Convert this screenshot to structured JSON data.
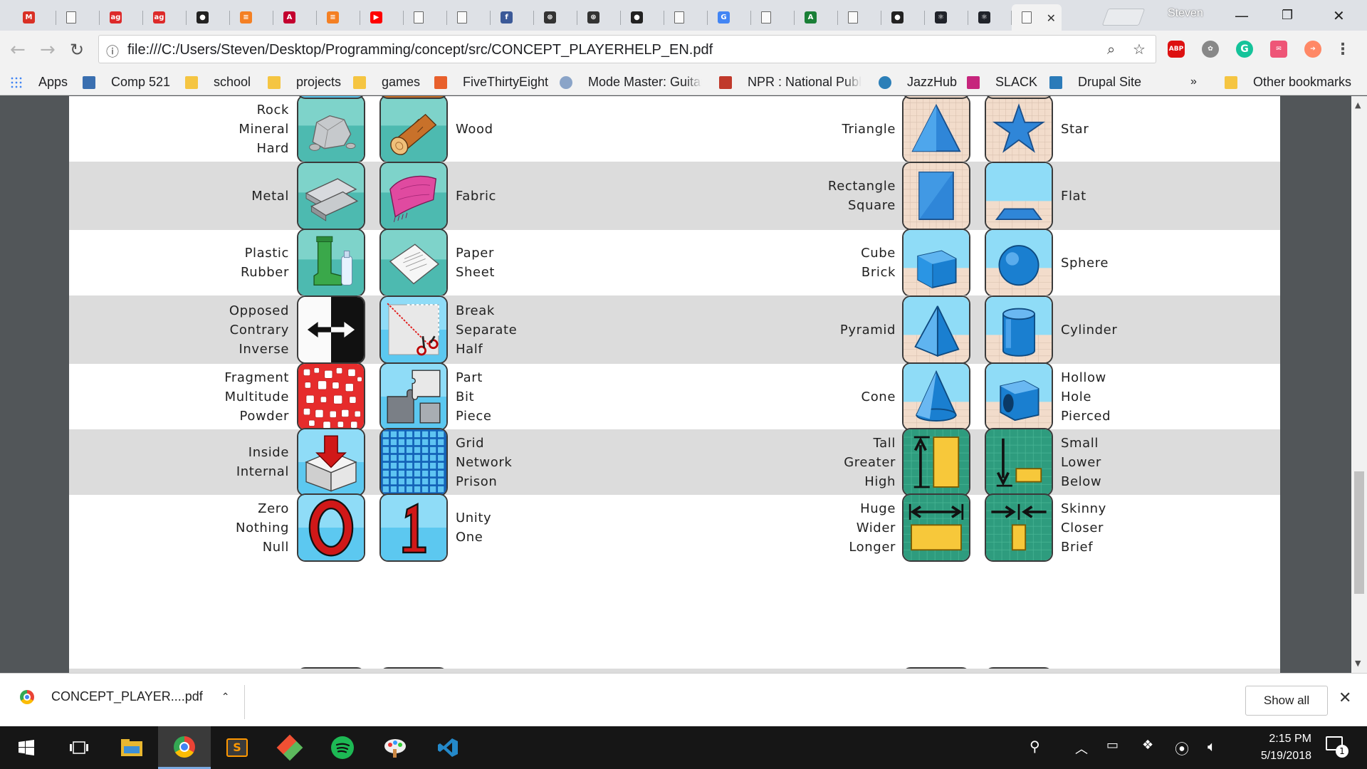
{
  "browser": {
    "profile_name": "Steven",
    "url": "file:///C:/Users/Steven/Desktop/Programming/concept/src/CONCEPT_PLAYERHELP_EN.pdf",
    "tabs": [
      {
        "icon": "gmail-icon",
        "color": "#d93025",
        "glyph": "M",
        "active": false
      },
      {
        "icon": "document-icon",
        "color": "#888888",
        "glyph": "",
        "active": false
      },
      {
        "icon": "ag-icon",
        "color": "#dd2a2a",
        "glyph": "ag",
        "active": false
      },
      {
        "icon": "ag-icon",
        "color": "#dd2a2a",
        "glyph": "ag",
        "active": false
      },
      {
        "icon": "github-icon",
        "color": "#222222",
        "glyph": "●",
        "active": false
      },
      {
        "icon": "stackoverflow-icon",
        "color": "#f48024",
        "glyph": "≡",
        "active": false
      },
      {
        "icon": "angular-icon",
        "color": "#c3002f",
        "glyph": "A",
        "active": false
      },
      {
        "icon": "stackoverflow-icon",
        "color": "#f48024",
        "glyph": "≡",
        "active": false
      },
      {
        "icon": "youtube-icon",
        "color": "#ff0000",
        "glyph": "▶",
        "active": false
      },
      {
        "icon": "document-icon",
        "color": "#888888",
        "glyph": "",
        "active": false
      },
      {
        "icon": "document-icon",
        "color": "#888888",
        "glyph": "",
        "active": false
      },
      {
        "icon": "facebook-icon",
        "color": "#3b5998",
        "glyph": "f",
        "active": false
      },
      {
        "icon": "circles-icon",
        "color": "#333333",
        "glyph": "⊛",
        "active": false
      },
      {
        "icon": "circles-icon",
        "color": "#333333",
        "glyph": "⊛",
        "active": false
      },
      {
        "icon": "github-icon",
        "color": "#222222",
        "glyph": "●",
        "active": false
      },
      {
        "icon": "document-icon",
        "color": "#888888",
        "glyph": "",
        "active": false
      },
      {
        "icon": "google-icon",
        "color": "#4285f4",
        "glyph": "G",
        "active": false
      },
      {
        "icon": "document-icon",
        "color": "#888888",
        "glyph": "",
        "active": false
      },
      {
        "icon": "terminal-icon",
        "color": "#1a7f37",
        "glyph": "A",
        "active": false
      },
      {
        "icon": "document-icon",
        "color": "#888888",
        "glyph": "",
        "active": false
      },
      {
        "icon": "github-icon",
        "color": "#222222",
        "glyph": "●",
        "active": false
      },
      {
        "icon": "react-icon",
        "color": "#20232a",
        "glyph": "⚛",
        "active": false
      },
      {
        "icon": "react-icon",
        "color": "#20232a",
        "glyph": "⚛",
        "active": false
      },
      {
        "icon": "document-icon",
        "color": "#888888",
        "glyph": "",
        "active": true
      }
    ],
    "bookmarks": [
      {
        "label": "Apps",
        "icon": "apps-grid-icon",
        "color": "#4285f4"
      },
      {
        "label": "Comp 521",
        "icon": "gear-bookmark-icon",
        "color": "#3a6fb0"
      },
      {
        "label": "school",
        "icon": "folder-icon",
        "color": "#f5c542"
      },
      {
        "label": "projects",
        "icon": "folder-icon",
        "color": "#f5c542"
      },
      {
        "label": "games",
        "icon": "folder-icon",
        "color": "#f5c542"
      },
      {
        "label": "FiveThirtyEight",
        "icon": "fivethirtyeight-icon",
        "color": "#e8602c"
      },
      {
        "label": "Mode Master: Guitar",
        "icon": "mode-master-icon",
        "color": "#8aa4c8"
      },
      {
        "label": "NPR : National Publi",
        "icon": "npr-icon",
        "color": "#c0392b"
      },
      {
        "label": "JazzHub",
        "icon": "jazzhub-icon",
        "color": "#2c7fb8"
      },
      {
        "label": "SLACK",
        "icon": "slack-icon",
        "color": "#c6257c"
      },
      {
        "label": "Drupal Site",
        "icon": "drupal-icon",
        "color": "#2b7bb9"
      }
    ],
    "bookmarks_overflow": "»",
    "other_bookmarks": "Other bookmarks"
  },
  "pdf": {
    "rows": [
      {
        "shade": false,
        "left": {
          "label": [
            "Rock",
            "Mineral",
            "Hard"
          ],
          "icon1": "rock-icon",
          "icon2": "wood-icon",
          "label2": [
            "Wood"
          ]
        },
        "right": {
          "label": [
            "Triangle"
          ],
          "icon1": "triangle-icon",
          "icon2": "star-icon",
          "label2": [
            "Star"
          ]
        }
      },
      {
        "shade": true,
        "left": {
          "label": [
            "Metal"
          ],
          "icon1": "metal-icon",
          "icon2": "fabric-icon",
          "label2": [
            "Fabric"
          ]
        },
        "right": {
          "label": [
            "Rectangle",
            "Square"
          ],
          "icon1": "rectangle-icon",
          "icon2": "flat-icon",
          "label2": [
            "Flat"
          ]
        }
      },
      {
        "shade": false,
        "left": {
          "label": [
            "Plastic",
            "Rubber"
          ],
          "icon1": "plastic-icon",
          "icon2": "paper-icon",
          "label2": [
            "Paper",
            "Sheet"
          ]
        },
        "right": {
          "label": [
            "Cube",
            "Brick"
          ],
          "icon1": "cube-icon",
          "icon2": "sphere-icon",
          "label2": [
            "Sphere"
          ]
        }
      },
      {
        "shade": true,
        "left": {
          "label": [
            "Opposed",
            "Contrary",
            "Inverse"
          ],
          "icon1": "opposed-icon",
          "icon2": "break-icon",
          "label2": [
            "Break",
            "Separate",
            "Half"
          ]
        },
        "right": {
          "label": [
            "Pyramid"
          ],
          "icon1": "pyramid-icon",
          "icon2": "cylinder-icon",
          "label2": [
            "Cylinder"
          ]
        }
      },
      {
        "shade": false,
        "left": {
          "label": [
            "Fragment",
            "Multitude",
            "Powder"
          ],
          "icon1": "fragment-icon",
          "icon2": "puzzle-icon",
          "label2": [
            "Part",
            "Bit",
            "Piece"
          ]
        },
        "right": {
          "label": [
            "Cone"
          ],
          "icon1": "cone-icon",
          "icon2": "hollow-icon",
          "label2": [
            "Hollow",
            "Hole",
            "Pierced"
          ]
        }
      },
      {
        "shade": true,
        "left": {
          "label": [
            "Inside",
            "Internal"
          ],
          "icon1": "inside-icon",
          "icon2": "grid-icon",
          "label2": [
            "Grid",
            "Network",
            "Prison"
          ]
        },
        "right": {
          "label": [
            "Tall",
            "Greater",
            "High"
          ],
          "icon1": "tall-icon",
          "icon2": "small-icon",
          "label2": [
            "Small",
            "Lower",
            "Below"
          ]
        }
      },
      {
        "shade": false,
        "left": {
          "label": [
            "Zero",
            "Nothing",
            "Null"
          ],
          "icon1": "zero-icon",
          "icon2": "one-icon",
          "label2": [
            "Unity",
            "One"
          ]
        },
        "right": {
          "label": [
            "Huge",
            "Wider",
            "Longer"
          ],
          "icon1": "huge-icon",
          "icon2": "skinny-icon",
          "label2": [
            "Skinny",
            "Closer",
            "Brief"
          ]
        }
      }
    ],
    "digits": {
      "zero": "0",
      "one": "1"
    }
  },
  "download": {
    "filename": "CONCEPT_PLAYER....pdf",
    "show_all": "Show all"
  },
  "taskbar": {
    "time": "2:15 PM",
    "date": "5/19/2018",
    "notifications": "1"
  }
}
